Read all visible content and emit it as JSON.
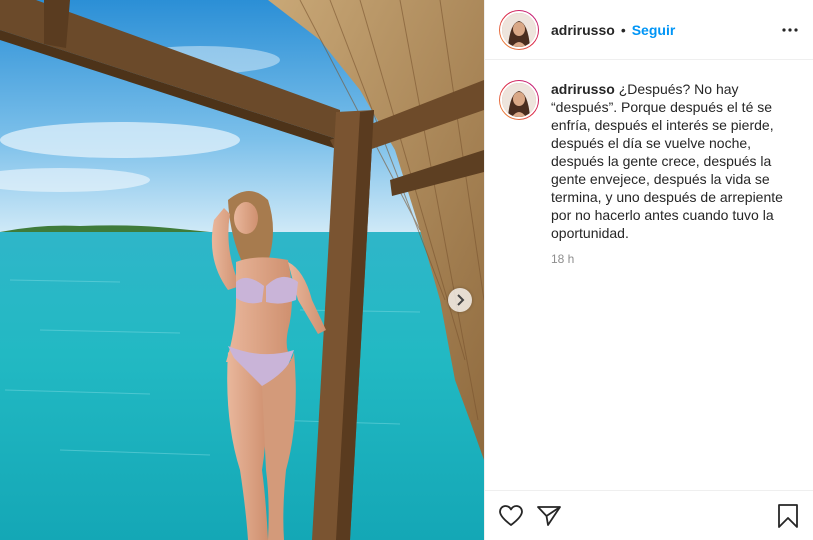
{
  "header": {
    "username": "adrirusso",
    "separator": "•",
    "follow_label": "Seguir"
  },
  "caption": {
    "username": "adrirusso",
    "text": "¿Después? No hay “después”. Porque después el té se enfría, después el interés se pierde, después el día se vuelve noche, después la gente crece, después la gente envejece, después la vida se termina, y uno después de arrepiente por no hacerlo antes cuando tuvo la oportunidad.",
    "time": "18 h"
  },
  "icons": {
    "more": "more-options-icon",
    "next": "chevron-right-icon",
    "like": "heart-icon",
    "share": "paper-plane-icon",
    "save": "bookmark-icon"
  },
  "colors": {
    "follow": "#0095f6",
    "text": "#262626",
    "muted": "#8e8e8e",
    "border": "#efefef",
    "sea": "#1fb7c4",
    "sky": "#4aa7dc"
  }
}
